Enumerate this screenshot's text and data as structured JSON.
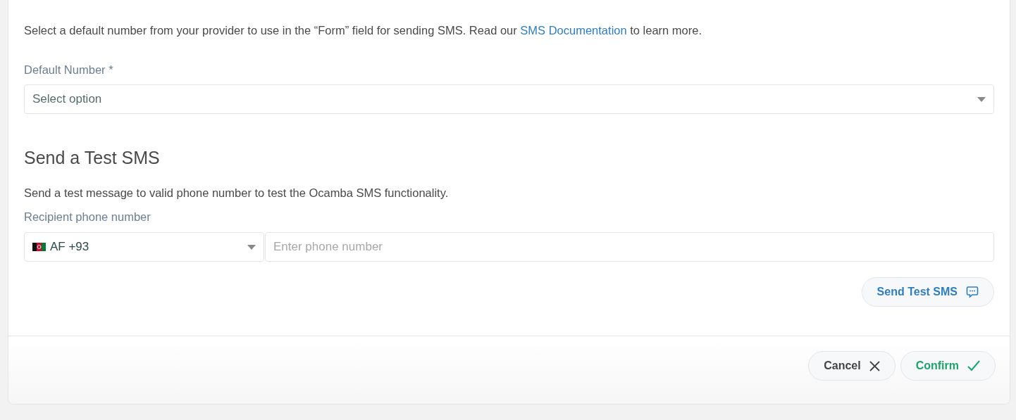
{
  "intro": {
    "before": "Select a default number from your provider to use in the “Form” field for sending SMS. Read our ",
    "link": "SMS Documentation",
    "after": " to learn more."
  },
  "default_number": {
    "label": "Default Number *",
    "placeholder": "Select option"
  },
  "test_section": {
    "heading": "Send a Test SMS",
    "description": "Send a test message to valid phone number to test the Ocamba SMS functionality.",
    "phone_label": "Recipient phone number",
    "country": "AF +93",
    "phone_placeholder": "Enter phone number",
    "send_button": "Send Test SMS"
  },
  "footer_buttons": [
    {
      "label": "Cancel",
      "kind": "cancel"
    },
    {
      "label": "Confirm",
      "kind": "confirm"
    }
  ]
}
